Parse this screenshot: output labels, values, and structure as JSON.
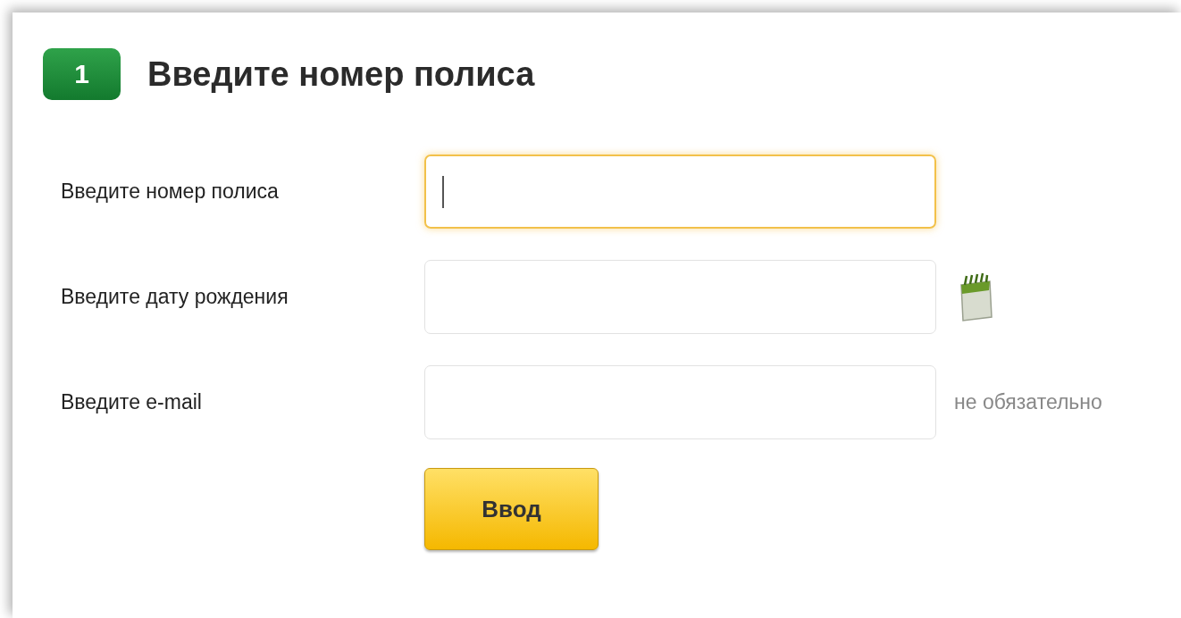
{
  "step": {
    "number": "1",
    "title": "Введите номер полиса"
  },
  "fields": [
    {
      "label": "Введите номер полиса",
      "kind": "text",
      "focused": true
    },
    {
      "label": "Введите дату рождения",
      "kind": "date",
      "focused": false
    },
    {
      "label": "Введите e-mail",
      "kind": "email",
      "focused": false,
      "note": "не обязательно"
    }
  ],
  "button": "Ввод"
}
